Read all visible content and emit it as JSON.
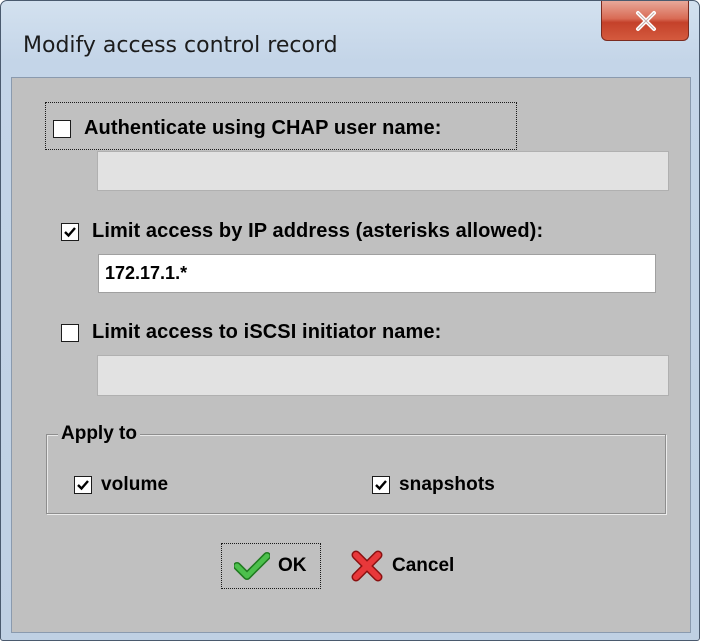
{
  "window": {
    "title": "Modify access control record",
    "close_symbol": "x"
  },
  "options": {
    "chap": {
      "label": "Authenticate using CHAP user name:",
      "checked": false,
      "value": ""
    },
    "ip": {
      "label": "Limit access by IP address (asterisks allowed):",
      "checked": true,
      "value": "172.17.1.*"
    },
    "iscsi": {
      "label": "Limit access to iSCSI initiator name:",
      "checked": false,
      "value": ""
    }
  },
  "apply_to": {
    "title": "Apply to",
    "volume_label": "volume",
    "volume_checked": true,
    "snapshots_label": "snapshots",
    "snapshots_checked": true
  },
  "buttons": {
    "ok_label": "OK",
    "cancel_label": "Cancel"
  },
  "icons": {
    "ok": "green-checkmark-icon",
    "cancel": "red-x-icon",
    "close": "close-icon"
  },
  "colors": {
    "ok_icon": "#3aa83a",
    "cancel_icon": "#d8282a",
    "close_button": "#c4412a"
  }
}
